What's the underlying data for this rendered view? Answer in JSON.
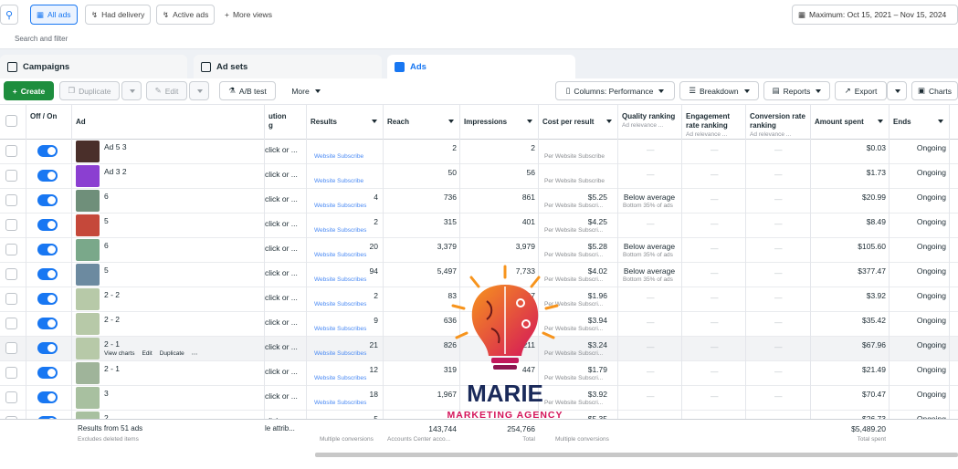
{
  "topbar": {
    "chips": [
      "All ads",
      "Had delivery",
      "Active ads"
    ],
    "more_views": "More views",
    "date_range": "Maximum: Oct 15, 2021 – Nov 15, 2024"
  },
  "filter": {
    "placeholder": "Search and filter"
  },
  "tabs": [
    "Campaigns",
    "Ad sets",
    "Ads"
  ],
  "toolbar": {
    "create": "Create",
    "duplicate": "Duplicate",
    "edit": "Edit",
    "ab_test": "A/B test",
    "more": "More",
    "columns": "Columns: Performance",
    "breakdown": "Breakdown",
    "reports": "Reports",
    "export": "Export",
    "charts": "Charts"
  },
  "headers": {
    "off_on": "Off / On",
    "ad": "Ad",
    "attribution": "ution\ng",
    "results": "Results",
    "reach": "Reach",
    "impressions": "Impressions",
    "cpr": "Cost per result",
    "quality": "Quality ranking",
    "quality_sub": "Ad relevance ...",
    "engagement": "Engagement rate ranking",
    "engagement_sub": "Ad relevance ...",
    "conversion": "Conversion rate ranking",
    "conversion_sub": "Ad relevance ...",
    "amount": "Amount spent",
    "ends": "Ends"
  },
  "rows": [
    {
      "name": "Ad 5 3",
      "attr": "click or ...",
      "results": "",
      "results_sub": "Website Subscribe",
      "reach": "2",
      "impr": "2",
      "cpr": "",
      "cpr_sub": "Per Website Subscribe",
      "quality": "—",
      "quality_sub": "",
      "eng": "—",
      "conv": "—",
      "amount": "$0.03",
      "ends": "Ongoing",
      "thumb": "#4a2f2a"
    },
    {
      "name": "Ad 3 2",
      "attr": "click or ...",
      "results": "",
      "results_sub": "Website Subscribe",
      "reach": "50",
      "impr": "56",
      "cpr": "",
      "cpr_sub": "Per Website Subscribe",
      "quality": "—",
      "quality_sub": "",
      "eng": "—",
      "conv": "—",
      "amount": "$1.73",
      "ends": "Ongoing",
      "thumb": "#8b3fd1"
    },
    {
      "name": "6",
      "attr": "click or ...",
      "results": "4",
      "results_sub": "Website Subscribes",
      "reach": "736",
      "impr": "861",
      "cpr": "$5.25",
      "cpr_sub": "Per Website Subscri...",
      "quality": "Below average",
      "quality_sub": "Bottom 35% of ads",
      "eng": "—",
      "conv": "—",
      "amount": "$20.99",
      "ends": "Ongoing",
      "thumb": "#6f8f7a"
    },
    {
      "name": "5",
      "attr": "click or ...",
      "results": "2",
      "results_sub": "Website Subscribes",
      "reach": "315",
      "impr": "401",
      "cpr": "$4.25",
      "cpr_sub": "Per Website Subscri...",
      "quality": "—",
      "quality_sub": "",
      "eng": "—",
      "conv": "—",
      "amount": "$8.49",
      "ends": "Ongoing",
      "thumb": "#c5483a"
    },
    {
      "name": "6",
      "attr": "click or ...",
      "results": "20",
      "results_sub": "Website Subscribes",
      "reach": "3,379",
      "impr": "3,979",
      "cpr": "$5.28",
      "cpr_sub": "Per Website Subscri...",
      "quality": "Below average",
      "quality_sub": "Bottom 35% of ads",
      "eng": "—",
      "conv": "—",
      "amount": "$105.60",
      "ends": "Ongoing",
      "thumb": "#7aa88a"
    },
    {
      "name": "5",
      "attr": "click or ...",
      "results": "94",
      "results_sub": "Website Subscribes",
      "reach": "5,497",
      "impr": "7,733",
      "cpr": "$4.02",
      "cpr_sub": "Per Website Subscri...",
      "quality": "Below average",
      "quality_sub": "Bottom 35% of ads",
      "eng": "—",
      "conv": "—",
      "amount": "$377.47",
      "ends": "Ongoing",
      "thumb": "#6c8aa0"
    },
    {
      "name": "2 - 2",
      "attr": "click or ...",
      "results": "2",
      "results_sub": "Website Subscribes",
      "reach": "83",
      "impr": "97",
      "cpr": "$1.96",
      "cpr_sub": "Per Website Subscri...",
      "quality": "—",
      "quality_sub": "",
      "eng": "—",
      "conv": "—",
      "amount": "$3.92",
      "ends": "Ongoing",
      "thumb": "#b7c9a8"
    },
    {
      "name": "2 - 2",
      "attr": "click or ...",
      "results": "9",
      "results_sub": "Website Subscribes",
      "reach": "636",
      "impr": "",
      "cpr": "$3.94",
      "cpr_sub": "Per Website Subscri...",
      "quality": "—",
      "quality_sub": "",
      "eng": "—",
      "conv": "—",
      "amount": "$35.42",
      "ends": "Ongoing",
      "thumb": "#b7c9a8"
    },
    {
      "name": "2 - 1",
      "attr": "click or ...",
      "results": "21",
      "results_sub": "Website Subscribes",
      "reach": "826",
      "impr": "1,211",
      "cpr": "$3.24",
      "cpr_sub": "Per Website Subscri...",
      "quality": "—",
      "quality_sub": "",
      "eng": "—",
      "conv": "—",
      "amount": "$67.96",
      "ends": "Ongoing",
      "thumb": "#b7c9a8",
      "hover": true
    },
    {
      "name": "2 - 1",
      "attr": "click or ...",
      "results": "12",
      "results_sub": "Website Subscribes",
      "reach": "319",
      "impr": "447",
      "cpr": "$1.79",
      "cpr_sub": "Per Website Subscri...",
      "quality": "—",
      "quality_sub": "",
      "eng": "—",
      "conv": "—",
      "amount": "$21.49",
      "ends": "Ongoing",
      "thumb": "#9fb49a"
    },
    {
      "name": "3",
      "attr": "click or ...",
      "results": "18",
      "results_sub": "Website Subscribes",
      "reach": "1,967",
      "impr": "",
      "cpr": "$3.92",
      "cpr_sub": "Per Website Subscri...",
      "quality": "—",
      "quality_sub": "",
      "eng": "—",
      "conv": "—",
      "amount": "$70.47",
      "ends": "Ongoing",
      "thumb": "#a8c0a0"
    },
    {
      "name": "2",
      "attr": "click or ...",
      "results": "5",
      "results_sub": "",
      "reach": "",
      "impr": "",
      "cpr": "$5.35",
      "cpr_sub": "",
      "quality": "—",
      "quality_sub": "",
      "eng": "—",
      "conv": "—",
      "amount": "$26.73",
      "ends": "Ongoing",
      "thumb": "#a8c0a0"
    }
  ],
  "hover_actions": [
    "View charts",
    "Edit",
    "Duplicate"
  ],
  "footer": {
    "results_label": "Results from 51 ads",
    "excludes": "Excludes deleted items",
    "attr": "le attrib...",
    "results_sub": "Multiple conversions",
    "reach": "143,744",
    "reach_sub": "Accounts Center acco...",
    "impr": "254,766",
    "impr_sub": "Total",
    "cpr_sub": "Multiple conversions",
    "amount": "$5,489.20",
    "amount_sub": "Total spent"
  },
  "overlay": {
    "brand": "MARIE",
    "tagline": "MARKETING AGENCY"
  }
}
